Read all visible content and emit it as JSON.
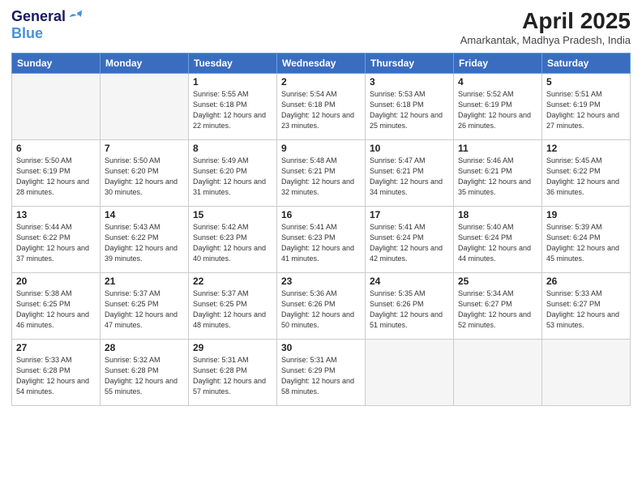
{
  "header": {
    "logo_general": "General",
    "logo_blue": "Blue",
    "month_year": "April 2025",
    "location": "Amarkantak, Madhya Pradesh, India"
  },
  "days_of_week": [
    "Sunday",
    "Monday",
    "Tuesday",
    "Wednesday",
    "Thursday",
    "Friday",
    "Saturday"
  ],
  "weeks": [
    [
      {
        "day": "",
        "empty": true
      },
      {
        "day": "",
        "empty": true
      },
      {
        "day": "1",
        "sunrise": "5:55 AM",
        "sunset": "6:18 PM",
        "daylight": "12 hours and 22 minutes."
      },
      {
        "day": "2",
        "sunrise": "5:54 AM",
        "sunset": "6:18 PM",
        "daylight": "12 hours and 23 minutes."
      },
      {
        "day": "3",
        "sunrise": "5:53 AM",
        "sunset": "6:18 PM",
        "daylight": "12 hours and 25 minutes."
      },
      {
        "day": "4",
        "sunrise": "5:52 AM",
        "sunset": "6:19 PM",
        "daylight": "12 hours and 26 minutes."
      },
      {
        "day": "5",
        "sunrise": "5:51 AM",
        "sunset": "6:19 PM",
        "daylight": "12 hours and 27 minutes."
      }
    ],
    [
      {
        "day": "6",
        "sunrise": "5:50 AM",
        "sunset": "6:19 PM",
        "daylight": "12 hours and 28 minutes."
      },
      {
        "day": "7",
        "sunrise": "5:50 AM",
        "sunset": "6:20 PM",
        "daylight": "12 hours and 30 minutes."
      },
      {
        "day": "8",
        "sunrise": "5:49 AM",
        "sunset": "6:20 PM",
        "daylight": "12 hours and 31 minutes."
      },
      {
        "day": "9",
        "sunrise": "5:48 AM",
        "sunset": "6:21 PM",
        "daylight": "12 hours and 32 minutes."
      },
      {
        "day": "10",
        "sunrise": "5:47 AM",
        "sunset": "6:21 PM",
        "daylight": "12 hours and 34 minutes."
      },
      {
        "day": "11",
        "sunrise": "5:46 AM",
        "sunset": "6:21 PM",
        "daylight": "12 hours and 35 minutes."
      },
      {
        "day": "12",
        "sunrise": "5:45 AM",
        "sunset": "6:22 PM",
        "daylight": "12 hours and 36 minutes."
      }
    ],
    [
      {
        "day": "13",
        "sunrise": "5:44 AM",
        "sunset": "6:22 PM",
        "daylight": "12 hours and 37 minutes."
      },
      {
        "day": "14",
        "sunrise": "5:43 AM",
        "sunset": "6:22 PM",
        "daylight": "12 hours and 39 minutes."
      },
      {
        "day": "15",
        "sunrise": "5:42 AM",
        "sunset": "6:23 PM",
        "daylight": "12 hours and 40 minutes."
      },
      {
        "day": "16",
        "sunrise": "5:41 AM",
        "sunset": "6:23 PM",
        "daylight": "12 hours and 41 minutes."
      },
      {
        "day": "17",
        "sunrise": "5:41 AM",
        "sunset": "6:24 PM",
        "daylight": "12 hours and 42 minutes."
      },
      {
        "day": "18",
        "sunrise": "5:40 AM",
        "sunset": "6:24 PM",
        "daylight": "12 hours and 44 minutes."
      },
      {
        "day": "19",
        "sunrise": "5:39 AM",
        "sunset": "6:24 PM",
        "daylight": "12 hours and 45 minutes."
      }
    ],
    [
      {
        "day": "20",
        "sunrise": "5:38 AM",
        "sunset": "6:25 PM",
        "daylight": "12 hours and 46 minutes."
      },
      {
        "day": "21",
        "sunrise": "5:37 AM",
        "sunset": "6:25 PM",
        "daylight": "12 hours and 47 minutes."
      },
      {
        "day": "22",
        "sunrise": "5:37 AM",
        "sunset": "6:25 PM",
        "daylight": "12 hours and 48 minutes."
      },
      {
        "day": "23",
        "sunrise": "5:36 AM",
        "sunset": "6:26 PM",
        "daylight": "12 hours and 50 minutes."
      },
      {
        "day": "24",
        "sunrise": "5:35 AM",
        "sunset": "6:26 PM",
        "daylight": "12 hours and 51 minutes."
      },
      {
        "day": "25",
        "sunrise": "5:34 AM",
        "sunset": "6:27 PM",
        "daylight": "12 hours and 52 minutes."
      },
      {
        "day": "26",
        "sunrise": "5:33 AM",
        "sunset": "6:27 PM",
        "daylight": "12 hours and 53 minutes."
      }
    ],
    [
      {
        "day": "27",
        "sunrise": "5:33 AM",
        "sunset": "6:28 PM",
        "daylight": "12 hours and 54 minutes."
      },
      {
        "day": "28",
        "sunrise": "5:32 AM",
        "sunset": "6:28 PM",
        "daylight": "12 hours and 55 minutes."
      },
      {
        "day": "29",
        "sunrise": "5:31 AM",
        "sunset": "6:28 PM",
        "daylight": "12 hours and 57 minutes."
      },
      {
        "day": "30",
        "sunrise": "5:31 AM",
        "sunset": "6:29 PM",
        "daylight": "12 hours and 58 minutes."
      },
      {
        "day": "",
        "empty": true
      },
      {
        "day": "",
        "empty": true
      },
      {
        "day": "",
        "empty": true
      }
    ]
  ]
}
